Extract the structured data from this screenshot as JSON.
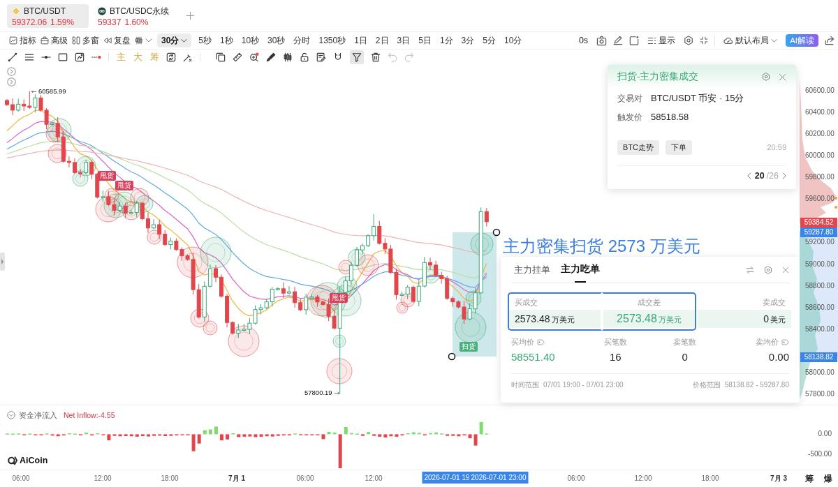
{
  "symbol_tabs": [
    {
      "pair": "BTC/USDT",
      "price": "59372.06",
      "change": "1.59%",
      "selected": true
    },
    {
      "pair": "BTC/USDC永续",
      "price": "59337",
      "change": "1.60%",
      "selected": false
    }
  ],
  "toolbar": {
    "tools": [
      {
        "label": "指标"
      },
      {
        "label": "高级"
      },
      {
        "label": "多窗"
      },
      {
        "label": "复盘"
      }
    ],
    "intervals": [
      {
        "label": "30分",
        "selected": true
      },
      {
        "label": "5秒",
        "selected": false
      },
      {
        "label": "1秒",
        "selected": false
      },
      {
        "label": "10秒",
        "selected": false
      },
      {
        "label": "30秒",
        "selected": false
      },
      {
        "label": "分时",
        "selected": false
      },
      {
        "label": "1350秒",
        "selected": false
      },
      {
        "label": "1日",
        "selected": false
      },
      {
        "label": "2日",
        "selected": false
      },
      {
        "label": "3日",
        "selected": false
      },
      {
        "label": "5日",
        "selected": false
      },
      {
        "label": "1分",
        "selected": false
      },
      {
        "label": "3分",
        "selected": false
      },
      {
        "label": "5分",
        "selected": false
      },
      {
        "label": "10分",
        "selected": false
      }
    ],
    "countdown": "0s",
    "display_label": "显示",
    "layout_label": "默认布局",
    "ai_button": "AI解读"
  },
  "drawing_toolbar": {
    "text_tools": [
      {
        "label": "主"
      },
      {
        "label": "大"
      },
      {
        "label": "筹"
      }
    ],
    "filter_selected": true,
    "undo_disabled": true,
    "redo_disabled": true
  },
  "chart": {
    "high_label": "60585.99",
    "low_label": "57800.19",
    "markers": [
      {
        "label": "甩货",
        "kind": "sell"
      },
      {
        "label": "甩货",
        "kind": "sell"
      },
      {
        "label": "甩货",
        "kind": "sell"
      },
      {
        "label": "扫货",
        "kind": "buy"
      }
    ],
    "headline": "主力密集扫货 2573 万美元"
  },
  "alert_popup": {
    "title": "扫货-主力密集成交",
    "fields": [
      {
        "label": "交易对",
        "value": "BTC/USDT 币安 · 15分"
      },
      {
        "label": "触发价",
        "value": "58518.58"
      }
    ],
    "buttons": [
      "BTC走势",
      "下单"
    ],
    "time": "20:59",
    "pager": {
      "current": "20",
      "total": "/26"
    }
  },
  "order_panel": {
    "tabs": [
      {
        "label": "主力挂单",
        "selected": false
      },
      {
        "label": "主力吃单",
        "selected": true
      }
    ],
    "summary": [
      {
        "label": "买成交",
        "value": "2573.48",
        "unit": "万美元",
        "highlighted": true,
        "color": "#1f2329"
      },
      {
        "label": "成交差",
        "value": "2573.48",
        "unit": "万美元",
        "highlighted": true,
        "color": "#3aa776"
      },
      {
        "label": "卖成交",
        "value": "0",
        "unit": "美元",
        "highlighted": false,
        "color": "#1f2329"
      }
    ],
    "stats": [
      {
        "label": "买均价",
        "value": "58551.40",
        "info_icon": true,
        "color": "#3aa776"
      },
      {
        "label": "买笔数",
        "value": "16",
        "info_icon": false,
        "color": "#1f2329"
      },
      {
        "label": "卖笔数",
        "value": "0",
        "info_icon": false,
        "color": "#1f2329"
      },
      {
        "label": "卖均价",
        "value": "0.00",
        "info_icon": true,
        "color": "#1f2329"
      }
    ],
    "footer": [
      {
        "label": "时间范围",
        "value": "07/01 19:00 - 07/01 23:00"
      },
      {
        "label": "价格范围",
        "value": "58138.82 - 59287.80"
      }
    ]
  },
  "price_axis": {
    "labels": [
      "60600.00",
      "60400.00",
      "60200.00",
      "60000.00",
      "59800.00",
      "59600.00",
      "59200.00",
      "59000.00",
      "58800.00",
      "58600.00",
      "58400.00",
      "58000.00",
      "57800.00"
    ],
    "tags": [
      {
        "value": "59384.52",
        "kind": "last"
      },
      {
        "value": "59287.80",
        "kind": "range"
      },
      {
        "value": "58138.82",
        "kind": "range"
      }
    ]
  },
  "net_inflow": {
    "title": "资金净流入",
    "reading": "Net Inflow:-4.55",
    "axis_labels": [
      "0.00",
      "-500.00"
    ]
  },
  "logo": "AiCoin",
  "time_axis": {
    "labels": [
      {
        "text": "06:00",
        "kind": "tick"
      },
      {
        "text": "12:00",
        "kind": "tick"
      },
      {
        "text": "18:00",
        "kind": "tick"
      },
      {
        "text": "7月 1",
        "kind": "day"
      },
      {
        "text": "06:00",
        "kind": "tick"
      },
      {
        "text": "12:00",
        "kind": "tick"
      },
      {
        "text": "2026-07-01 19",
        "kind": "cursor"
      },
      {
        "text": "2026-07-01 23:00",
        "kind": "cursor"
      },
      {
        "text": "06:00",
        "kind": "tick"
      },
      {
        "text": "12:00",
        "kind": "tick"
      },
      {
        "text": "18:00",
        "kind": "tick"
      },
      {
        "text": "7月 3",
        "kind": "day"
      }
    ]
  },
  "side_buttons": [
    {
      "label": "筹"
    },
    {
      "label": "爆"
    }
  ]
}
